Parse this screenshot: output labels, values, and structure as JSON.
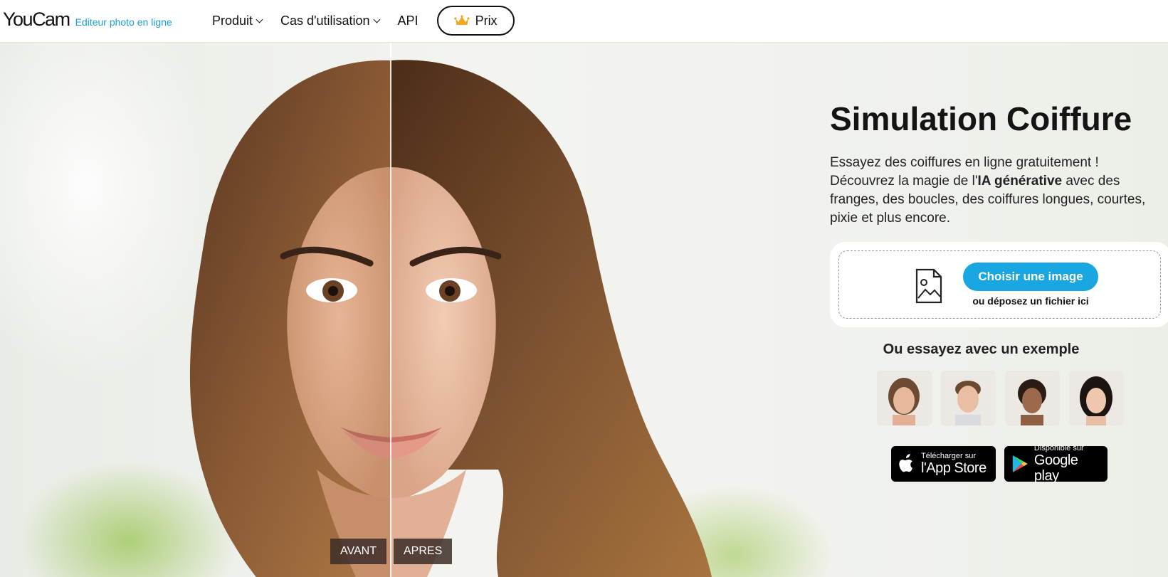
{
  "header": {
    "logo_text": "YouCam",
    "logo_tagline": "Editeur photo en ligne",
    "nav": [
      {
        "label": "Produit",
        "has_dropdown": true
      },
      {
        "label": "Cas d'utilisation",
        "has_dropdown": true
      },
      {
        "label": "API",
        "has_dropdown": false
      }
    ],
    "prix_label": "Prix",
    "prix_icon": "crown-icon"
  },
  "hero": {
    "before_label": "AVANT",
    "after_label": "APRES",
    "title": "Simulation Coiffure",
    "desc_part1": "Essayez des coiffures en ligne gratuitement ! Découvrez la magie de l'",
    "desc_bold": "IA générative",
    "desc_part2": " avec des franges, des boucles, des coiffures longues, courtes, pixie et plus encore.",
    "upload": {
      "button_label": "Choisir une image",
      "drop_text": "ou déposez un fichier ici",
      "icon": "image-file-icon"
    },
    "examples_title": "Ou essayez avec un exemple",
    "stores": [
      {
        "small": "Télécharger sur",
        "big": "l'App Store",
        "icon": "apple-icon"
      },
      {
        "small": "Disponible sur",
        "big": "Google play",
        "icon": "google-play-icon"
      }
    ]
  },
  "colors": {
    "accent": "#1aa6e0",
    "tagline": "#1a9fdb",
    "label_bg": "#3c2d28",
    "crown": "#f2a91e"
  }
}
